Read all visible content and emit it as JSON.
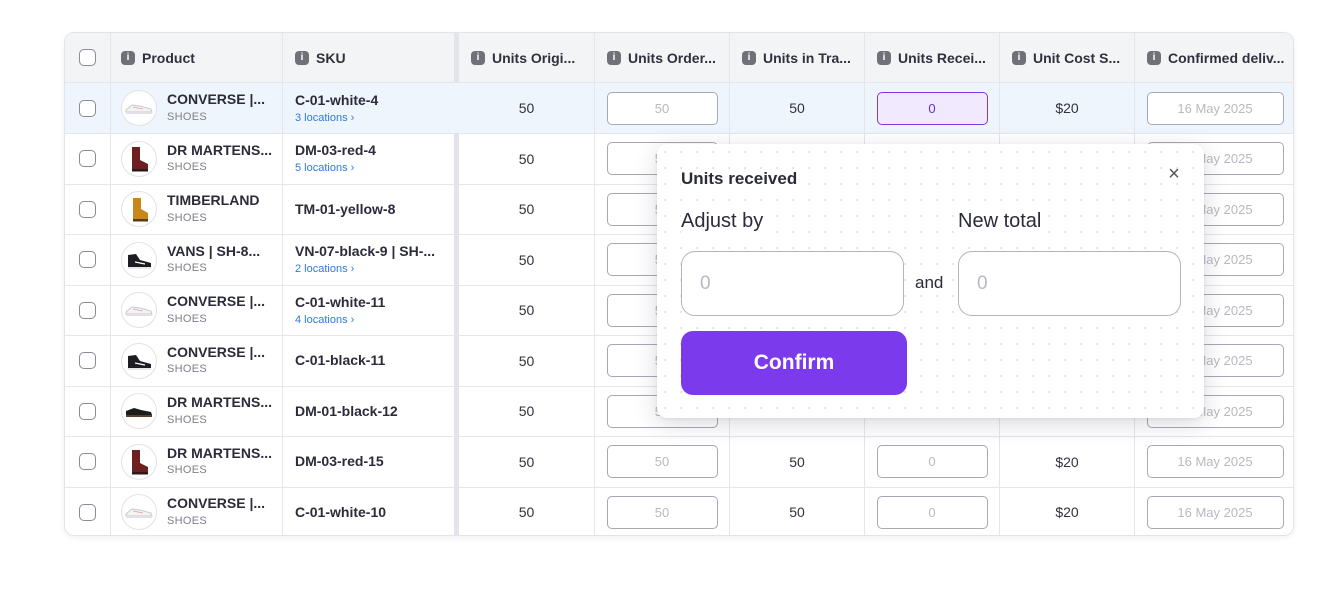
{
  "columns": {
    "product": "Product",
    "sku": "SKU",
    "units_original": "Units Origi...",
    "units_ordered": "Units Order...",
    "units_in_transit": "Units in Tra...",
    "units_received": "Units Recei...",
    "unit_cost": "Unit Cost S...",
    "confirmed_delivery": "Confirmed deliv..."
  },
  "rows": [
    {
      "name": "CONVERSE |...",
      "category": "SHOES",
      "sku": "C-01-white-4",
      "locations": "3 locations",
      "units_original": "50",
      "units_ordered": "50",
      "units_in_transit": "50",
      "units_received": "0",
      "unit_cost": "$20",
      "delivery": "16 May 2025",
      "image": "white-sneaker-icon"
    },
    {
      "name": "DR MARTENS...",
      "category": "SHOES",
      "sku": "DM-03-red-4",
      "locations": "5 locations",
      "units_original": "50",
      "units_ordered": "50",
      "units_in_transit": "",
      "units_received": "",
      "unit_cost": "",
      "delivery": "16 May 2025",
      "image": "red-boot-icon"
    },
    {
      "name": "TIMBERLAND",
      "category": "SHOES",
      "sku": "TM-01-yellow-8",
      "locations": "",
      "units_original": "50",
      "units_ordered": "50",
      "units_in_transit": "",
      "units_received": "",
      "unit_cost": "",
      "delivery": "16 May 2025",
      "image": "yellow-boot-icon"
    },
    {
      "name": "VANS | SH-8...",
      "category": "SHOES",
      "sku": "VN-07-black-9 | SH-...",
      "locations": "2 locations",
      "units_original": "50",
      "units_ordered": "50",
      "units_in_transit": "",
      "units_received": "",
      "unit_cost": "",
      "delivery": "16 May 2025",
      "image": "black-sneaker-icon"
    },
    {
      "name": "CONVERSE |...",
      "category": "SHOES",
      "sku": "C-01-white-11",
      "locations": "4 locations",
      "units_original": "50",
      "units_ordered": "50",
      "units_in_transit": "",
      "units_received": "",
      "unit_cost": "",
      "delivery": "16 May 2025",
      "image": "white-sneaker-icon"
    },
    {
      "name": "CONVERSE |...",
      "category": "SHOES",
      "sku": "C-01-black-11",
      "locations": "",
      "units_original": "50",
      "units_ordered": "50",
      "units_in_transit": "",
      "units_received": "",
      "unit_cost": "",
      "delivery": "16 May 2025",
      "image": "black-sneaker-icon"
    },
    {
      "name": "DR MARTENS...",
      "category": "SHOES",
      "sku": "DM-01-black-12",
      "locations": "",
      "units_original": "50",
      "units_ordered": "50",
      "units_in_transit": "",
      "units_received": "",
      "unit_cost": "",
      "delivery": "16 May 2025",
      "image": "black-shoe-icon"
    },
    {
      "name": "DR MARTENS...",
      "category": "SHOES",
      "sku": "DM-03-red-15",
      "locations": "",
      "units_original": "50",
      "units_ordered": "50",
      "units_in_transit": "50",
      "units_received": "0",
      "unit_cost": "$20",
      "delivery": "16 May 2025",
      "image": "red-boot-icon"
    },
    {
      "name": "CONVERSE |...",
      "category": "SHOES",
      "sku": "C-01-white-10",
      "locations": "",
      "units_original": "50",
      "units_ordered": "50",
      "units_in_transit": "50",
      "units_received": "0",
      "unit_cost": "$20",
      "delivery": "16 May 2025",
      "image": "white-sneaker-icon"
    }
  ],
  "popover": {
    "title": "Units received",
    "adjust_label": "Adjust by",
    "adjust_placeholder": "0",
    "and_label": "and",
    "total_label": "New total",
    "total_placeholder": "0",
    "confirm_label": "Confirm",
    "close_glyph": "×"
  },
  "colors": {
    "accent": "#7c3aed",
    "link": "#2f7bd9",
    "selected_row": "#eff5fd"
  },
  "icons": {
    "info": "i",
    "chevron": "›"
  }
}
